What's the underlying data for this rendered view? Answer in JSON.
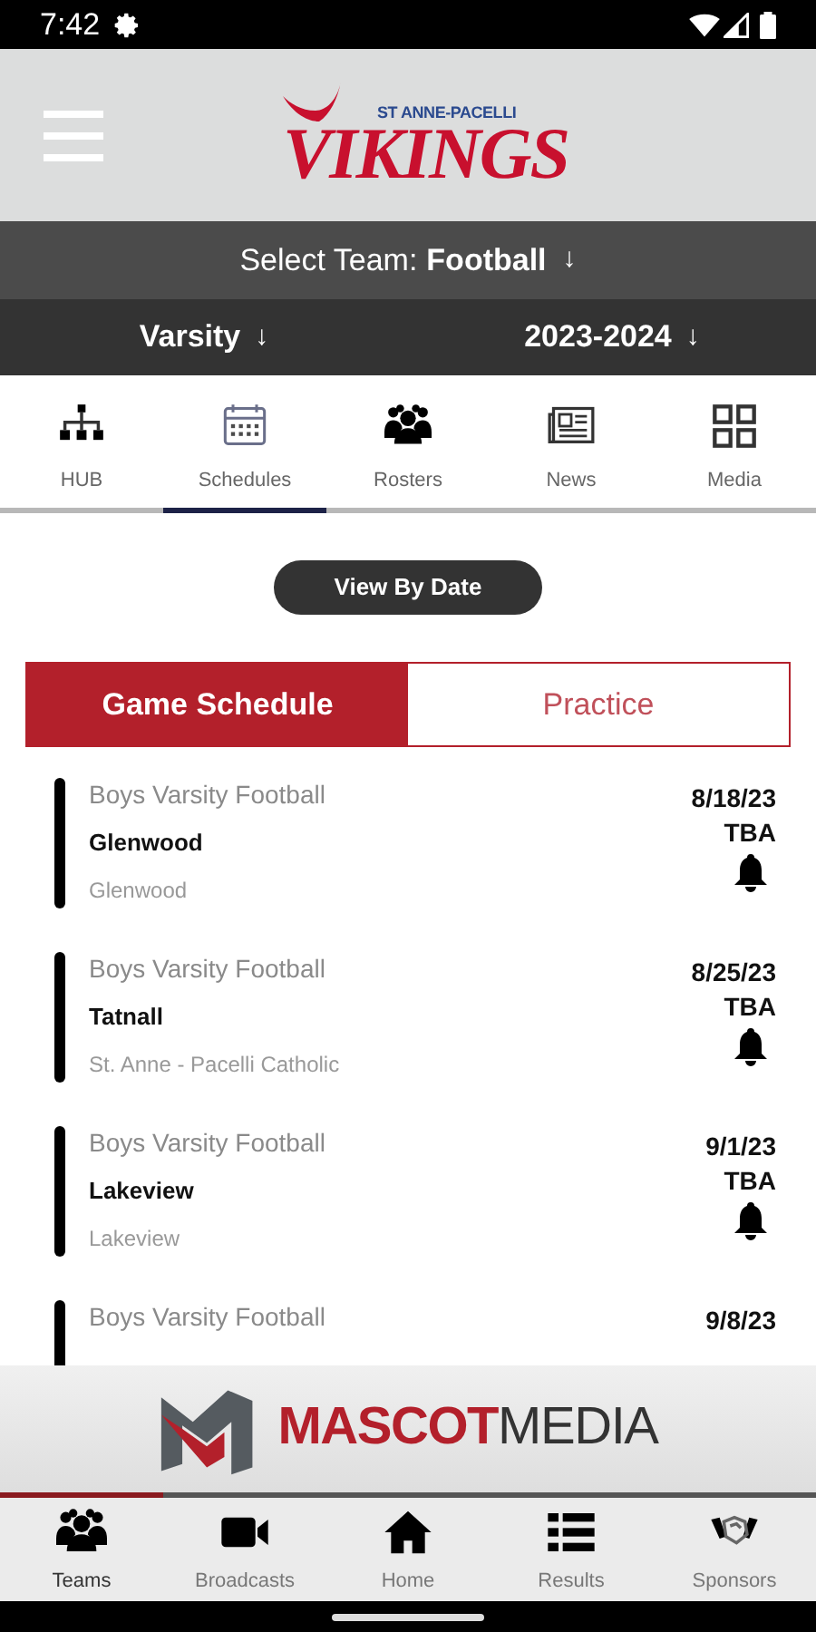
{
  "status_bar": {
    "time": "7:42"
  },
  "header": {
    "logo_small": "ST ANNE-PACELLI",
    "logo_main": "VIKINGS"
  },
  "team_select": {
    "label": "Select Team:",
    "value": "Football",
    "arrow": "↓"
  },
  "filters": [
    {
      "value": "Varsity",
      "arrow": "↓"
    },
    {
      "value": "2023-2024",
      "arrow": "↓"
    }
  ],
  "tabs": [
    {
      "label": "HUB",
      "selected": false
    },
    {
      "label": "Schedules",
      "selected": true
    },
    {
      "label": "Rosters",
      "selected": false
    },
    {
      "label": "News",
      "selected": false
    },
    {
      "label": "Media",
      "selected": false
    }
  ],
  "view_button": "View By Date",
  "segments": [
    {
      "label": "Game Schedule",
      "selected": true
    },
    {
      "label": "Practice",
      "selected": false
    }
  ],
  "games": [
    {
      "team": "Boys Varsity Football",
      "opponent": "Glenwood",
      "location": "Glenwood",
      "date": "8/18/23",
      "time": "TBA"
    },
    {
      "team": "Boys Varsity Football",
      "opponent": "Tatnall",
      "location": "St. Anne - Pacelli Catholic",
      "date": "8/25/23",
      "time": "TBA"
    },
    {
      "team": "Boys Varsity Football",
      "opponent": "Lakeview",
      "location": "Lakeview",
      "date": "9/1/23",
      "time": "TBA"
    },
    {
      "team": "Boys Varsity Football",
      "date": "9/8/23"
    }
  ],
  "banner": {
    "brand_bold": "MASCOT",
    "brand_light": "MEDIA"
  },
  "bottom_nav": [
    {
      "label": "Teams",
      "selected": true
    },
    {
      "label": "Broadcasts",
      "selected": false
    },
    {
      "label": "Home",
      "selected": false
    },
    {
      "label": "Results",
      "selected": false
    },
    {
      "label": "Sponsors",
      "selected": false
    }
  ]
}
